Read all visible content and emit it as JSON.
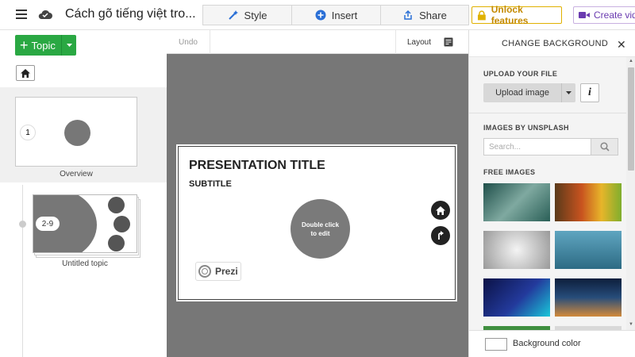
{
  "header": {
    "doc_title": "Cách gõ tiếng việt tro...",
    "style_label": "Style",
    "insert_label": "Insert",
    "share_label": "Share",
    "unlock_label": "Unlock features",
    "create_label": "Create vid"
  },
  "left_panel": {
    "topic_label": "Topic",
    "overview_number": "1",
    "overview_label": "Overview",
    "topic_range": "2-9",
    "topic_label_2": "Untitled topic"
  },
  "canvas_toolbar": {
    "undo_label": "Undo",
    "layout_label": "Layout"
  },
  "slide": {
    "title": "PRESENTATION TITLE",
    "subtitle": "SUBTITLE",
    "circle_line1": "Double click",
    "circle_line2": "to edit",
    "brand": "Prezi"
  },
  "right_panel": {
    "title": "CHANGE BACKGROUND",
    "upload_section": "UPLOAD YOUR FILE",
    "upload_button": "Upload image",
    "info_icon_text": "i",
    "unsplash_section": "IMAGES BY UNSPLASH",
    "search_placeholder": "Search...",
    "free_images_section": "FREE IMAGES",
    "background_color_label": "Background color"
  },
  "colors": {
    "topic_green": "#2aa843",
    "unlock_gold": "#c48a00",
    "create_purple": "#6a3bb0",
    "canvas_gray": "#777777"
  }
}
